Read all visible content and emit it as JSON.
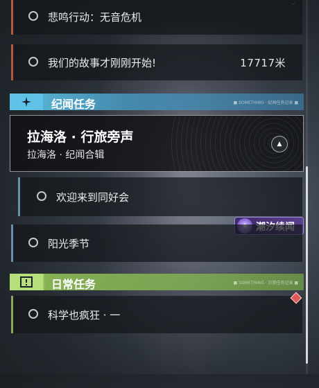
{
  "quests_top": [
    {
      "label": "悲鸣行动：无音危机",
      "distance": ""
    },
    {
      "label": "我们的故事才刚刚开始!",
      "distance": "17717米"
    }
  ],
  "section_story": {
    "title": "纪闻任务",
    "tag": "■ SOMETHING · 纪闻任务记录 ■"
  },
  "feature": {
    "title": "拉海洛 · 行旅旁声",
    "subtitle": "拉海洛 · 纪闻合辑"
  },
  "sub_quest": {
    "label": "欢迎来到同好会"
  },
  "badge": {
    "label": "潮汐续闻"
  },
  "quest_mid": {
    "label": "阳光季节"
  },
  "section_daily": {
    "title": "日常任务",
    "tag": "■ SOMETHING · 日常任务记录 ■"
  },
  "quest_daily": {
    "label": "科学也疯狂 · 一"
  },
  "colors": {
    "story_accent": "#5fc3e8",
    "daily_accent": "#b7e07a",
    "badge": "#5a3f8e",
    "quest_border": "#b45a3a"
  }
}
